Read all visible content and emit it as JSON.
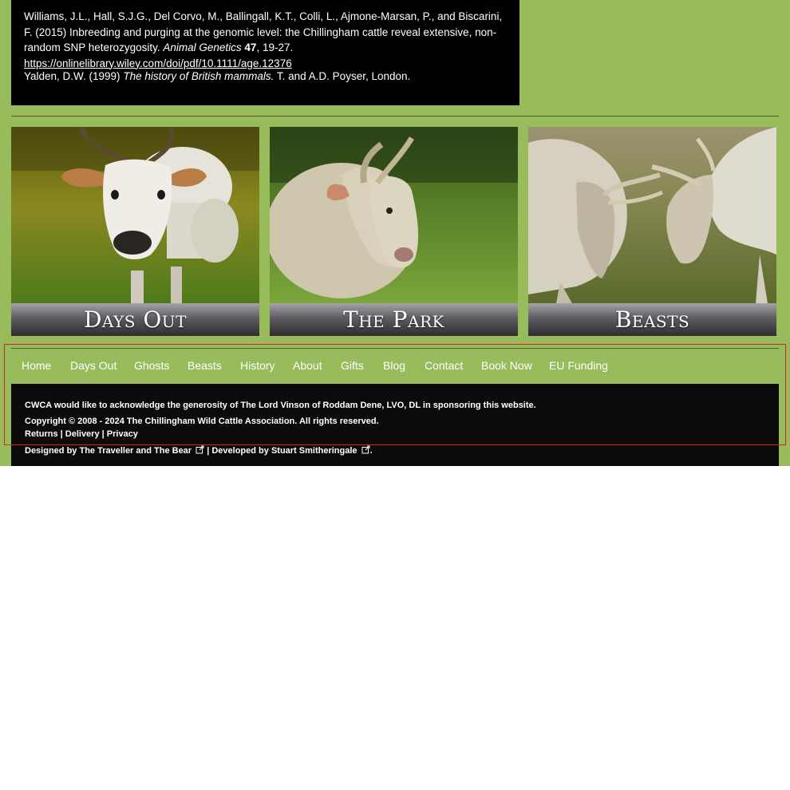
{
  "references": [
    {
      "authors": "Williams, J.L., Hall, S.J.G., Del Corvo, M., Ballingall, K.T., Colli, L., Ajmone-Marsan, P., and Biscarini, F. (2015) Inbreeding and purging at the genomic level: the Chillingham cattle reveal extensive, non-random SNP heterozygosity.",
      "journal": "Animal Genetics",
      "volume": "47",
      "pages": ", 19-27.",
      "url": "https://onlinelibrary.wiley.com/doi/pdf/10.1111/age.12376"
    },
    {
      "authors": "Yalden, D.W. (1999)",
      "title": "The history of British mammals.",
      "publisher": "T. and A.D. Poyser, London."
    }
  ],
  "tiles": [
    {
      "caption": "Days Out",
      "image": "white cow walking towards camera"
    },
    {
      "caption": "The Park",
      "image": "shaggy white bull calf in profile"
    },
    {
      "caption": "Beasts",
      "image": "two white bulls locking horns"
    }
  ],
  "nav": {
    "items": [
      "Home",
      "Days Out",
      "Ghosts",
      "Beasts",
      "History",
      "About",
      "Gifts",
      "Blog",
      "Contact",
      "Book Now",
      "EU Funding"
    ]
  },
  "footer": {
    "acknowledgement": "CWCA would like to acknowledge the generosity of The Lord Vinson of Roddam Dene, LVO, DL in sponsoring this website.",
    "copyright": "Copyright © 2008 - 2024 The Chillingham Wild Cattle Association. All rights reserved.",
    "links": [
      "Returns",
      "Delivery",
      "Privacy"
    ],
    "separator": "|",
    "designed_by_prefix": "Designed by",
    "designer": "The Traveller and The Bear",
    "developed_by_prefix": "| Developed by",
    "developer": "Stuart Smitheringale",
    "end": ".",
    "external_icon": "external-link-icon"
  },
  "colors": {
    "page_green": "#98bb5c",
    "panel_black": "#000000",
    "highlight_red": "#d8242a"
  }
}
